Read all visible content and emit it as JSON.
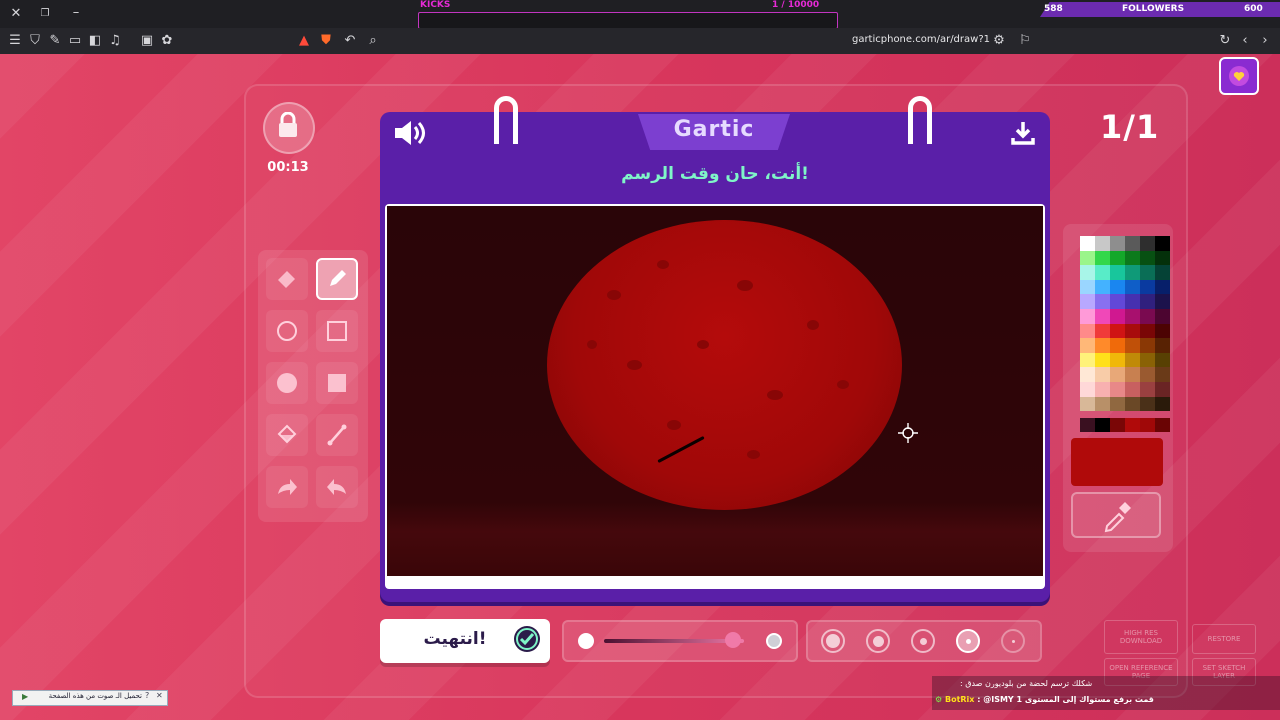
{
  "browser": {
    "url": "garticphone.com/ar/draw?1"
  },
  "stream": {
    "kicks_label": "KICKS",
    "kicks_count": "1 / 10000",
    "followers_left": "588",
    "followers_label": "FOLLOWERS",
    "followers_right": "600"
  },
  "game": {
    "timer": "00:13",
    "round": "1/1",
    "logo": "Gartic",
    "prompt": "أنت، حان وقت الرسم!",
    "done_label": "انتهيت!",
    "current_color": "#b00a0a",
    "palette": [
      "#ffffff",
      "#c8c8c8",
      "#8e8e8e",
      "#5a5a5a",
      "#2e2e2e",
      "#000000",
      "#9af58a",
      "#33d74a",
      "#14a82a",
      "#0c7a1c",
      "#075012",
      "#04300a",
      "#a8f5e8",
      "#58ecc8",
      "#18c69c",
      "#0f9a78",
      "#0a6e56",
      "#054236",
      "#9ad6ff",
      "#44b2ff",
      "#1a86f0",
      "#0f5ec8",
      "#0a3aa0",
      "#071f6a",
      "#b8a8ff",
      "#8870f0",
      "#6248d8",
      "#4630b0",
      "#30207e",
      "#1c124c",
      "#ff9ad8",
      "#f048b8",
      "#d01890",
      "#a8106e",
      "#7a0a50",
      "#4c0530",
      "#ff8a8a",
      "#f03a3a",
      "#d01414",
      "#a80c0c",
      "#7a0606",
      "#4c0303",
      "#ffb878",
      "#ff8a2a",
      "#f06a0a",
      "#c05008",
      "#8a3805",
      "#582203",
      "#fff27a",
      "#ffe01a",
      "#f0b80a",
      "#c08a08",
      "#8a6205",
      "#584003",
      "#ffe8d6",
      "#f8cca8",
      "#e8a878",
      "#c88050",
      "#9a5a30",
      "#6a3a18",
      "#ffd8d8",
      "#f8b0b0",
      "#e88888",
      "#c86060",
      "#9a4040",
      "#6a2424",
      "#d8b898",
      "#b89068",
      "#906840",
      "#6a4826",
      "#4a3018",
      "#2a1a0a"
    ],
    "recent_colors": [
      "#3a1020",
      "#000000",
      "#7a0606",
      "#b00a0a",
      "#a00808",
      "#6a0404"
    ],
    "opacity_level": 0.92,
    "ghost_buttons": {
      "high_res": "HIGH RES DOWNLOAD",
      "restore": "RESTORE",
      "open_ref": "OPEN REFERENCE PAGE",
      "set_sketch": "SET SKETCH LAYER"
    }
  },
  "chat": {
    "line1": "شكلك ترسم لحضة من بلوديورن صدق :",
    "line2_user": "BotRix",
    "line2_text": ": @ISMY 1 قمت برفع مستواك إلى المستوى"
  },
  "infobar": {
    "text": "تحميل الـ صوت من هذه الصفحة"
  }
}
